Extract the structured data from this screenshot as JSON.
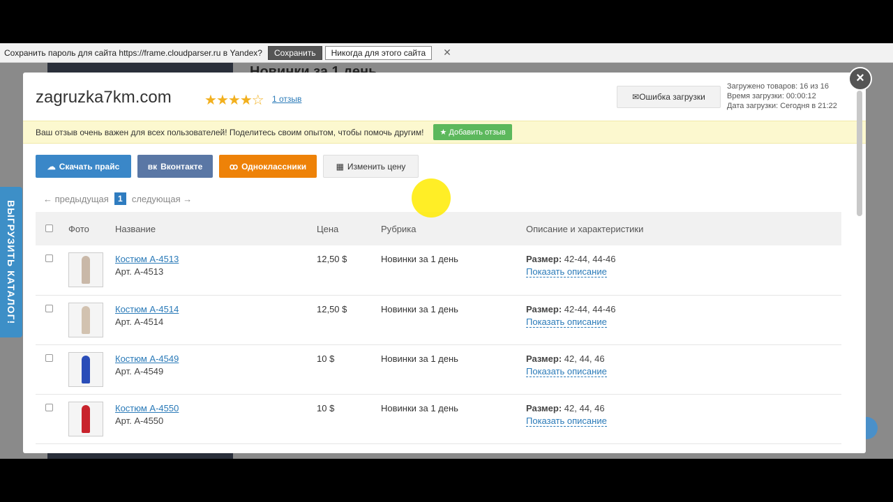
{
  "password_bar": {
    "text": "Сохранить пароль для сайта https://frame.cloudparser.ru в Yandex?",
    "save_label": "Сохранить",
    "never_label": "Никогда для этого сайта",
    "close": "✕"
  },
  "background_page": {
    "title": "Новинки за 1 день",
    "side_tab": "ВЫГРУЗИТЬ КАТАЛОГ!"
  },
  "modal": {
    "close": "×",
    "site_name": "zagruzka7km.com",
    "rating_stars": 4,
    "reviews_link": "1 отзыв",
    "error_button": "Ошибка загрузки",
    "meta": {
      "loaded": "Загружено товаров: 16 из 16",
      "load_time": "Время загрузки: 00:00:12",
      "load_date": "Дата загрузки: Сегодня в 21:22"
    },
    "notice": {
      "text": "Ваш отзыв очень важен для всех пользователей! Поделитесь своим опытом, чтобы помочь другим!",
      "button": "Добавить отзыв"
    },
    "actions": {
      "download": "Скачать прайс",
      "vk": "Вконтакте",
      "ok": "Одноклассники",
      "change_price": "Изменить цену"
    },
    "pager": {
      "prev": "← предыдущая",
      "current": "1",
      "next": "следующая →"
    },
    "table": {
      "headers": {
        "photo": "Фото",
        "name": "Название",
        "price": "Цена",
        "category": "Рубрика",
        "description": "Описание и характеристики"
      },
      "rows": [
        {
          "name": "Костюм А-4513",
          "article": "Арт. А-4513",
          "price": "12,50 $",
          "category": "Новинки за 1 день",
          "size_label": "Размер:",
          "size": "42-44, 44-46",
          "show": "Показать описание",
          "color": "#c9b8a8"
        },
        {
          "name": "Костюм А-4514",
          "article": "Арт. А-4514",
          "price": "12,50 $",
          "category": "Новинки за 1 день",
          "size_label": "Размер:",
          "size": "42-44, 44-46",
          "show": "Показать описание",
          "color": "#d2c2b0"
        },
        {
          "name": "Костюм А-4549",
          "article": "Арт. А-4549",
          "price": "10 $",
          "category": "Новинки за 1 день",
          "size_label": "Размер:",
          "size": "42, 44, 46",
          "show": "Показать описание",
          "color": "#2a4db8"
        },
        {
          "name": "Костюм А-4550",
          "article": "Арт. А-4550",
          "price": "10 $",
          "category": "Новинки за 1 день",
          "size_label": "Размер:",
          "size": "42, 44, 46",
          "show": "Показать описание",
          "color": "#c8232c"
        }
      ]
    }
  }
}
